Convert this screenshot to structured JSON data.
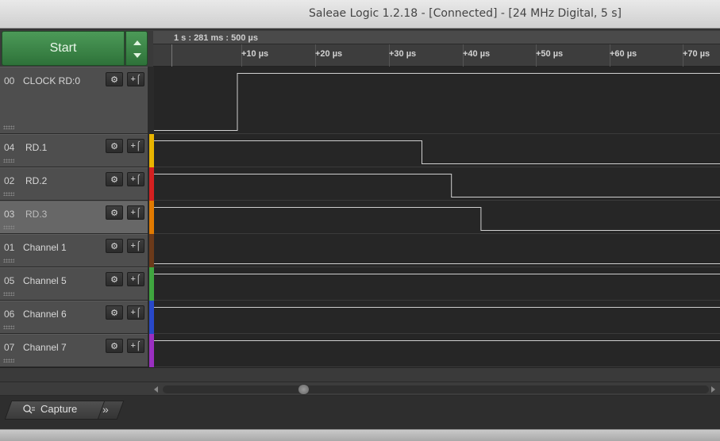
{
  "window": {
    "title": "Saleae Logic 1.2.18 - [Connected] - [24 MHz Digital, 5 s]"
  },
  "toolbar": {
    "start_label": "Start"
  },
  "ruler": {
    "reference": "1 s : 281 ms : 500 µs",
    "ticks": [
      "+10 µs",
      "+20 µs",
      "+30 µs",
      "+40 µs",
      "+50 µs",
      "+60 µs",
      "+70 µs"
    ]
  },
  "channels": [
    {
      "number": "00",
      "name": "CLOCK RD:0",
      "color": "#2a2a2a",
      "transition_us": 11.5,
      "initial": "low"
    },
    {
      "number": "04",
      "name": "RD.1",
      "color": "#e8b400",
      "transition_us": 36.5,
      "initial": "high"
    },
    {
      "number": "02",
      "name": "RD.2",
      "color": "#d42020",
      "transition_us": 40.5,
      "initial": "high"
    },
    {
      "number": "03",
      "name": "RD.3",
      "color": "#e07a00",
      "transition_us": 44.5,
      "initial": "high"
    },
    {
      "number": "01",
      "name": "Channel 1",
      "color": "#6b3a1a",
      "transition_us": null,
      "initial": "low"
    },
    {
      "number": "05",
      "name": "Channel 5",
      "color": "#3fa63f",
      "transition_us": null,
      "initial": "high"
    },
    {
      "number": "06",
      "name": "Channel 6",
      "color": "#2848c8",
      "transition_us": null,
      "initial": "high"
    },
    {
      "number": "07",
      "name": "Channel 7",
      "color": "#9a2fc0",
      "transition_us": null,
      "initial": "high"
    }
  ],
  "channel_buttons": {
    "settings_icon": "gear-icon",
    "trigger_icon": "trigger-edge-icon"
  },
  "tabs": {
    "capture_label": "Capture",
    "more_label": "»"
  }
}
